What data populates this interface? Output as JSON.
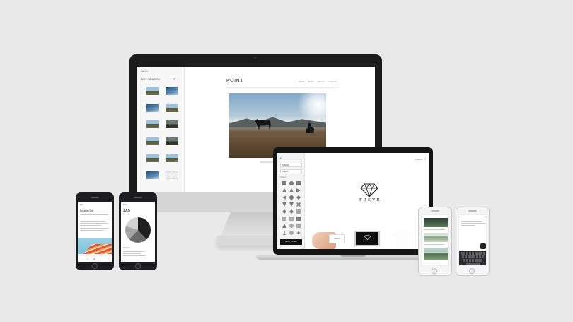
{
  "desktop": {
    "back_label": "BACK",
    "album_title": "DRY SEASON",
    "tools_icons": "⚙ ⋮",
    "site_brand": "POINT",
    "site_nav": [
      "HOME",
      "BLOG",
      "ABOUT",
      "CONTACT"
    ],
    "apple_logo": ""
  },
  "laptop": {
    "close_icon": "✕",
    "menu_icon": "≡",
    "top_label": "FREVR",
    "fields": [
      "FREVR",
      "Tagline"
    ],
    "shapes_label": "Shapes",
    "button_label": "NEXT STEP",
    "brand": "FREVR",
    "card_text": "FREVR"
  },
  "phones": {
    "article": {
      "top": "Edit",
      "title": "Double Grid",
      "tabs": [
        "⌂",
        "◎",
        "▦",
        "♡",
        "☰"
      ]
    },
    "stats": {
      "header": "Data",
      "value": "37.5",
      "caption": "Analytics"
    }
  },
  "colors": {
    "background": "#e9e9e9",
    "bezel": "#1b1b1b",
    "accent": "#e5533b"
  }
}
